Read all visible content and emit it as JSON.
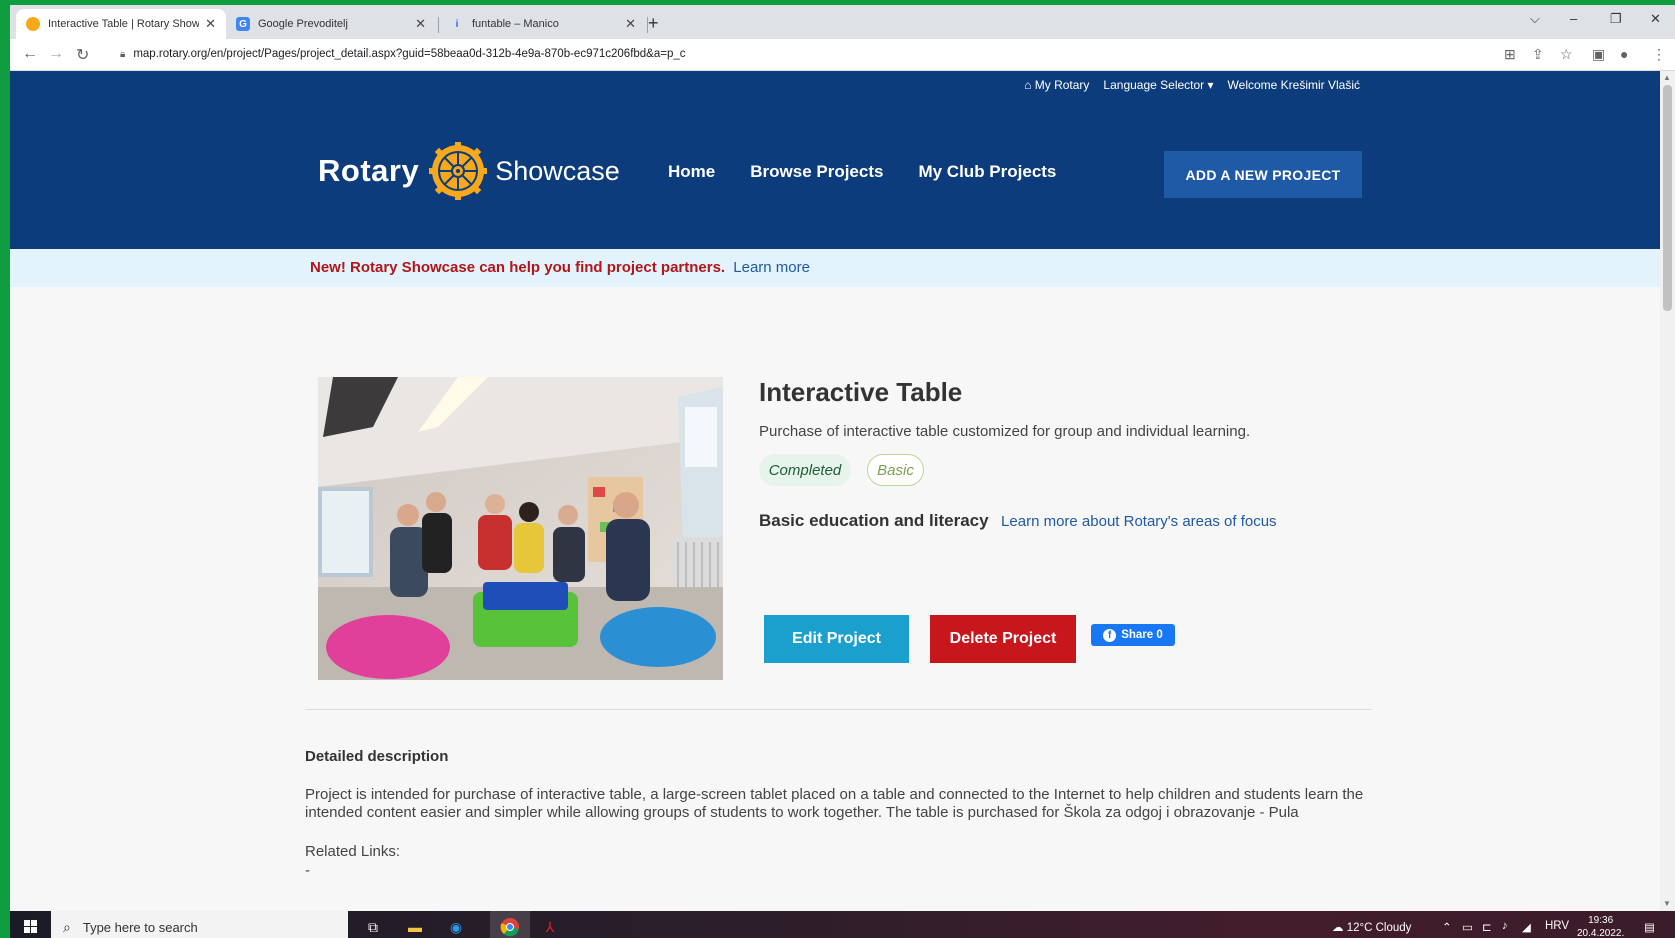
{
  "browser": {
    "tabs": [
      {
        "title": "Interactive Table | Rotary Showca",
        "active": true
      },
      {
        "title": "Google Prevoditelj",
        "active": false
      },
      {
        "title": "funtable – Manico",
        "active": false
      }
    ],
    "url": "map.rotary.org/en/project/Pages/project_detail.aspx?guid=58beaa0d-312b-4e9a-870b-ec971c206fbd&a=p_c"
  },
  "util_bar": {
    "my_rotary": "My Rotary",
    "language_selector": "Language Selector ▾",
    "welcome": "Welcome Krešimir Vlašić"
  },
  "header": {
    "logo_rotary": "Rotary",
    "logo_showcase": "Showcase",
    "nav": [
      "Home",
      "Browse Projects",
      "My Club Projects"
    ],
    "add_project": "ADD A NEW PROJECT"
  },
  "banner": {
    "message": "New! Rotary Showcase can help you find project partners.",
    "link": "Learn more"
  },
  "project": {
    "title": "Interactive Table",
    "summary": "Purchase of interactive table customized for group and individual learning.",
    "status": "Completed",
    "level": "Basic",
    "area_of_focus": "Basic education and literacy",
    "focus_link": "Learn more about Rotary's areas of focus",
    "edit_label": "Edit Project",
    "delete_label": "Delete Project",
    "share_label": "Share 0"
  },
  "details": {
    "heading": "Detailed description",
    "text": "Project is intended for purchase of interactive table, a large-screen tablet placed on a table and connected to the Internet to help children and students learn the intended content easier and simpler while allowing groups of students to work together. The table is purchased for Škola za odgoj i obrazovanje - Pula",
    "related_label": "Related Links:",
    "related_value": "-"
  },
  "taskbar": {
    "search_placeholder": "Type here to search",
    "weather": "12°C  Cloudy",
    "lang": "HRV",
    "time": "19:36",
    "date": "20.4.2022."
  },
  "colors": {
    "header_blue": "#0c3c7c",
    "edit_button": "#1b9fcc",
    "delete_button": "#c8161d",
    "banner_red": "#b1161b",
    "rotary_gold": "#f7a81b"
  }
}
